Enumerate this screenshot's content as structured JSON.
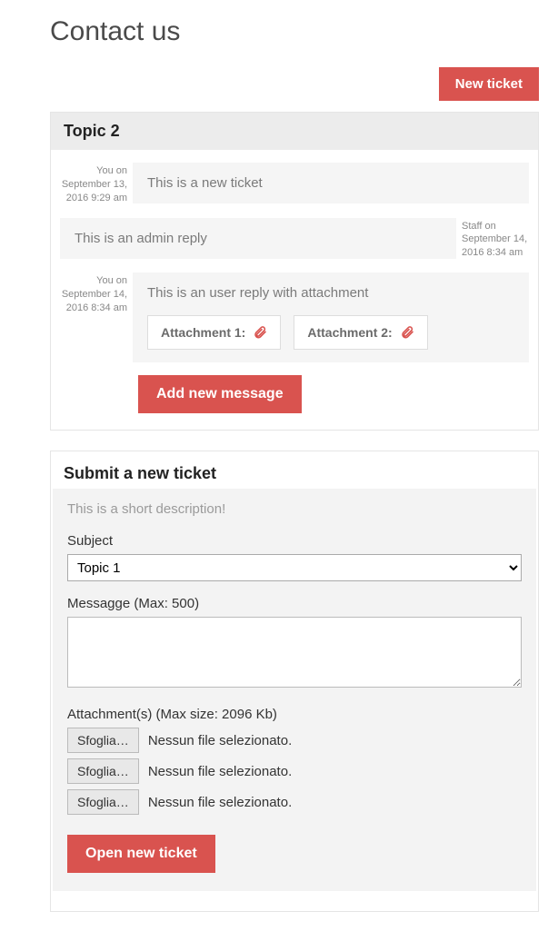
{
  "page": {
    "title": "Contact us"
  },
  "topbar": {
    "new_ticket_label": "New ticket"
  },
  "thread": {
    "topic_title": "Topic 2",
    "messages": [
      {
        "meta_author": "You on",
        "meta_date": "September 13, 2016 9:29 am",
        "body": "This is a new ticket",
        "side": "left"
      },
      {
        "meta_author": "Staff on",
        "meta_date": "September 14, 2016 8:34 am",
        "body": "This is an admin reply",
        "side": "right"
      },
      {
        "meta_author": "You on",
        "meta_date": "September 14, 2016 8:34 am",
        "body": "This is an user reply with attachment",
        "side": "left",
        "attachments": [
          {
            "label": "Attachment 1:"
          },
          {
            "label": "Attachment 2:"
          }
        ]
      }
    ],
    "add_message_label": "Add new message"
  },
  "form": {
    "title": "Submit a new ticket",
    "description": "This is a short description!",
    "subject_label": "Subject",
    "subject_value": "Topic 1",
    "message_label": "Messagge (Max: 500)",
    "attachments_label": "Attachment(s) (Max size: 2096 Kb)",
    "file_button_label": "Sfoglia…",
    "file_status": "Nessun file selezionato.",
    "submit_label": "Open new ticket"
  }
}
